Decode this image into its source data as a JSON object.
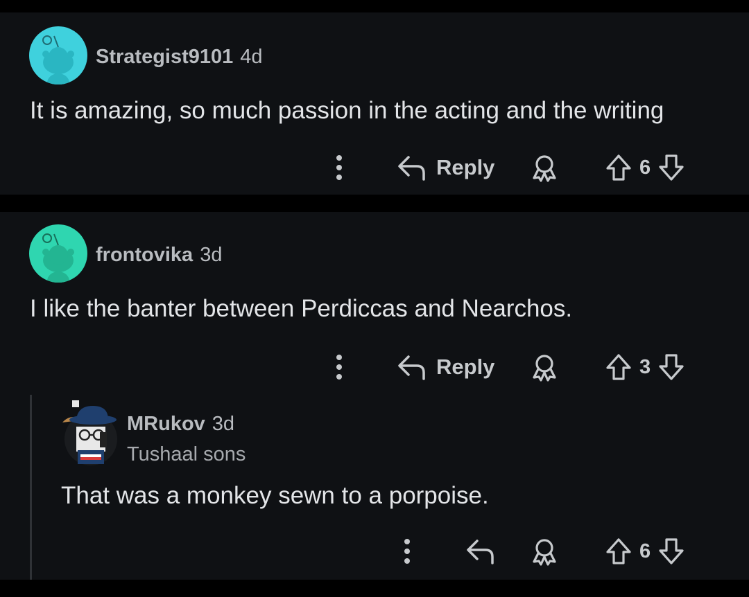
{
  "comments": [
    {
      "username": "Strategist9101",
      "age": "4d",
      "body": "It is amazing, so much passion in the acting and the writing",
      "reply_label": "Reply",
      "votes": "6",
      "avatar_color": "#3fd1dd"
    },
    {
      "username": "frontovika",
      "age": "3d",
      "body": "I like the banter between Perdiccas and Nearchos.",
      "reply_label": "Reply",
      "votes": "3",
      "avatar_color": "#2fd6b0"
    }
  ],
  "reply": {
    "username": "MRukov",
    "age": "3d",
    "flair": "Tushaal sons",
    "body": "That was a monkey sewn to a porpoise.",
    "votes": "6"
  },
  "icons": {
    "more": "more-options-icon",
    "reply": "reply-arrow-icon",
    "award": "award-icon",
    "upvote": "upvote-icon",
    "downvote": "downvote-icon"
  },
  "colors": {
    "background": "#000000",
    "card": "#0f1114",
    "text": "#e3e5e8",
    "muted": "#b9bcc0"
  }
}
